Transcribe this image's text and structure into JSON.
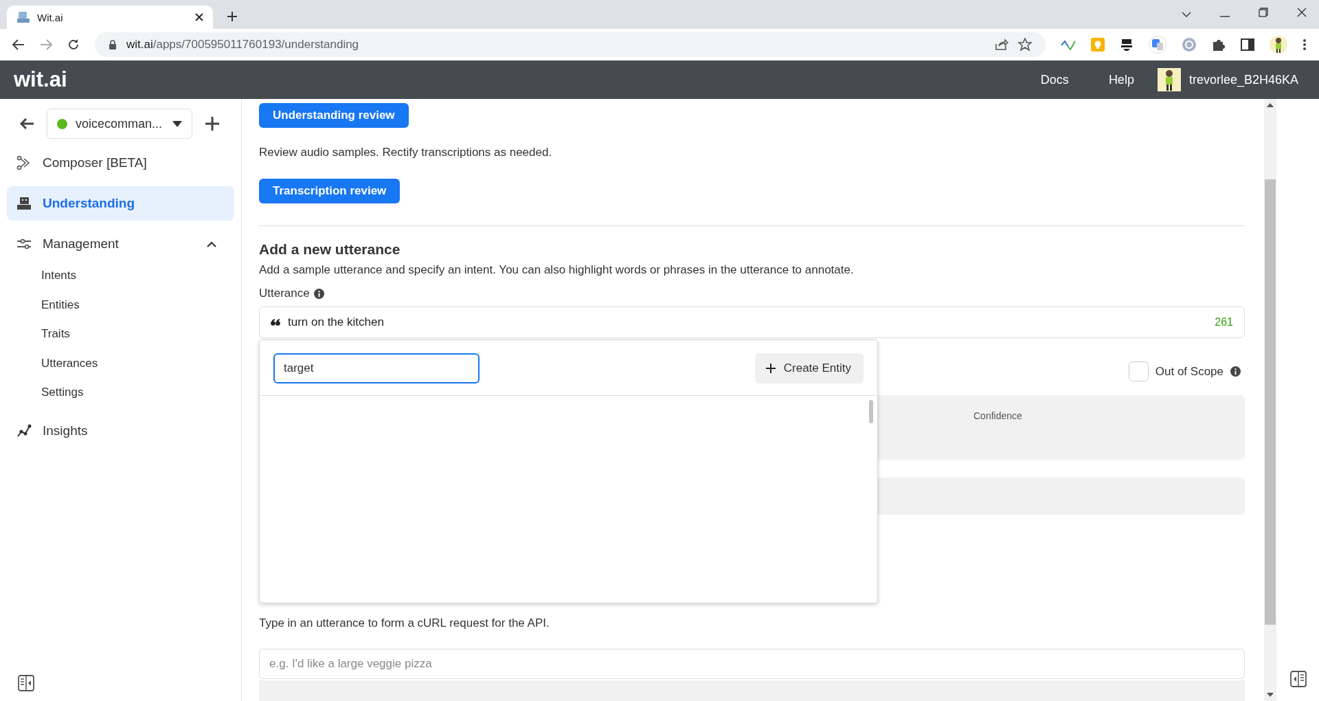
{
  "browser": {
    "tab": {
      "title": "Wit.ai",
      "selected": true
    },
    "url": {
      "host": "wit.ai",
      "path": "/apps/700595011760193/understanding"
    }
  },
  "app_header": {
    "logo": "wit.ai",
    "links": [
      "Docs",
      "Help"
    ],
    "user": "trevorlee_B2H46KA"
  },
  "sidebar": {
    "project": "voicecomman...",
    "items": [
      {
        "label": "Composer [BETA]",
        "selected": false
      },
      {
        "label": "Understanding",
        "selected": true
      },
      {
        "label": "Management",
        "selected": false,
        "expanded": true,
        "children": [
          {
            "label": "Intents"
          },
          {
            "label": "Entities"
          },
          {
            "label": "Traits"
          },
          {
            "label": "Utterances"
          },
          {
            "label": "Settings"
          }
        ]
      },
      {
        "label": "Insights",
        "selected": false
      }
    ]
  },
  "main": {
    "understanding_button": "Understanding review",
    "review_text": "Review audio samples. Rectify transcriptions as needed.",
    "transcription_button": "Transcription review",
    "utterance": {
      "title": "Add a new utterance",
      "description": "Add a sample utterance and specify an intent. You can also highlight words or phrases in the utterance to annotate.",
      "label": "Utterance",
      "value": "turn on the kitchen",
      "count": "261"
    },
    "entity_popup": {
      "search_value": "target",
      "create_button": "Create Entity"
    },
    "out_of_scope": {
      "label": "Out of Scope",
      "checked": false
    },
    "confidence_header": "Confidence",
    "api": {
      "description": "Type in an utterance to form a cURL request for the API.",
      "placeholder": "e.g. I'd like a large veggie pizza"
    }
  }
}
